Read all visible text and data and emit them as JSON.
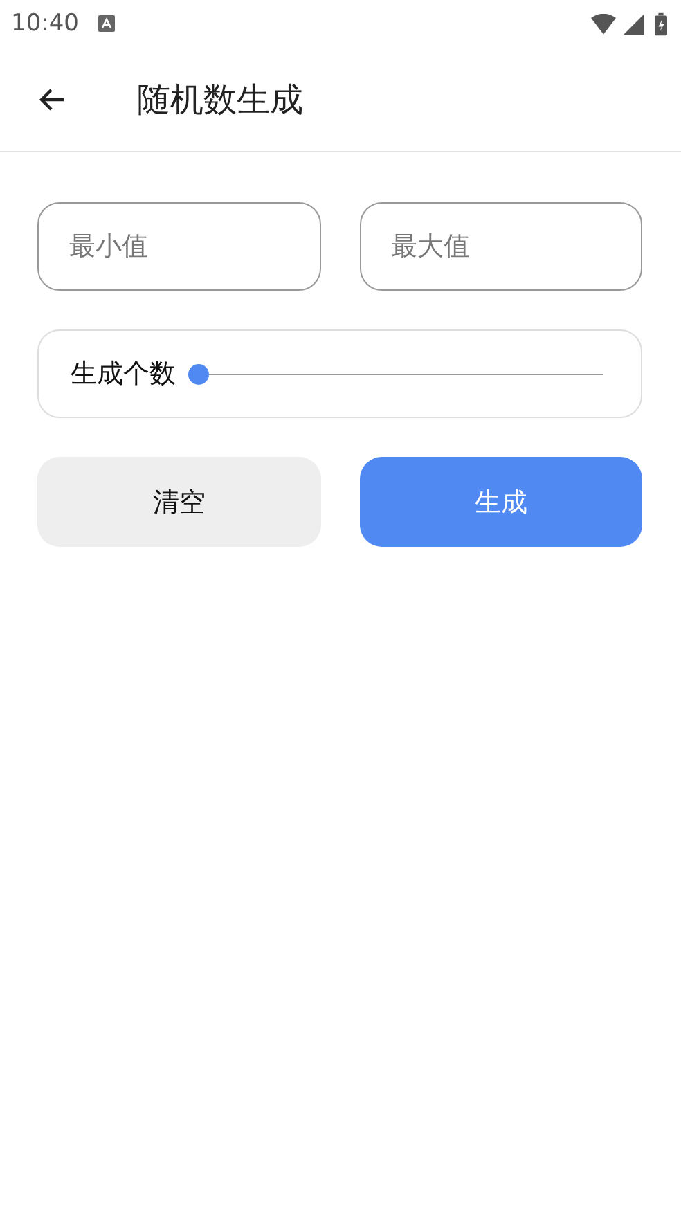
{
  "status_bar": {
    "time": "10:40"
  },
  "app_bar": {
    "title": "随机数生成"
  },
  "fields": [
    {
      "placeholder": "最小值"
    },
    {
      "placeholder": "最大值"
    }
  ],
  "count_slider": {
    "label": "生成个数",
    "level": 0
  },
  "buttons": [
    {
      "label": "清空",
      "kind": "secondary"
    },
    {
      "label": "生成",
      "kind": "primary"
    }
  ]
}
